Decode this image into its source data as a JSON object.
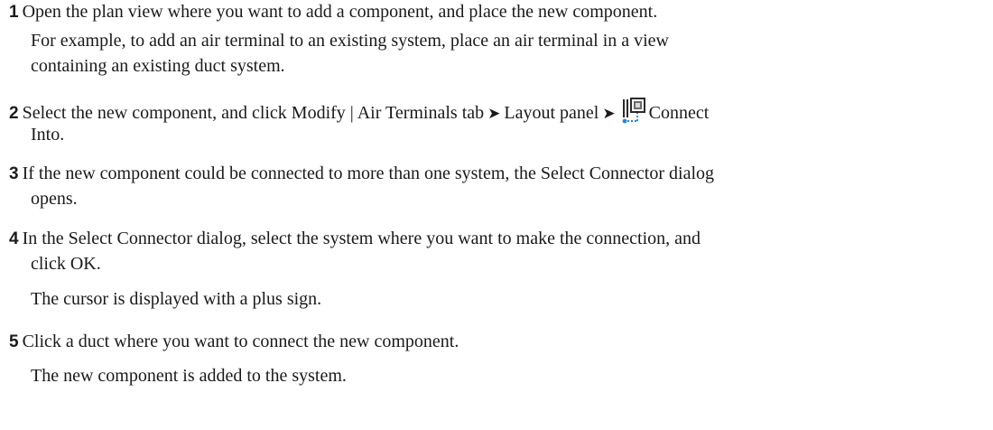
{
  "steps": [
    {
      "number": "1",
      "text": "Open the plan view where you want to add a component, and place the new component.",
      "note_lines": [
        "For example, to add an air terminal to an existing system, place an air terminal in a view",
        "containing an existing duct system."
      ]
    },
    {
      "number": "2",
      "text_before": "Select the new component, and click Modify | Air Terminals tab",
      "arrow": "➤",
      "text_middle": "Layout panel",
      "arrow2": "➤",
      "icon": "connect-into-icon",
      "text_after": "Connect",
      "continuation": "Into."
    },
    {
      "number": "3",
      "text_lines": [
        "If the new component could be connected to more than one system, the Select Connector dialog",
        "opens."
      ]
    },
    {
      "number": "4",
      "text_lines": [
        "In the Select Connector dialog, select the system where you want to make the connection, and",
        "click OK."
      ],
      "note": "The cursor is displayed with a plus sign."
    },
    {
      "number": "5",
      "text": "Click a duct where you want to connect the new component.",
      "note": "The new component is added to the system."
    }
  ]
}
